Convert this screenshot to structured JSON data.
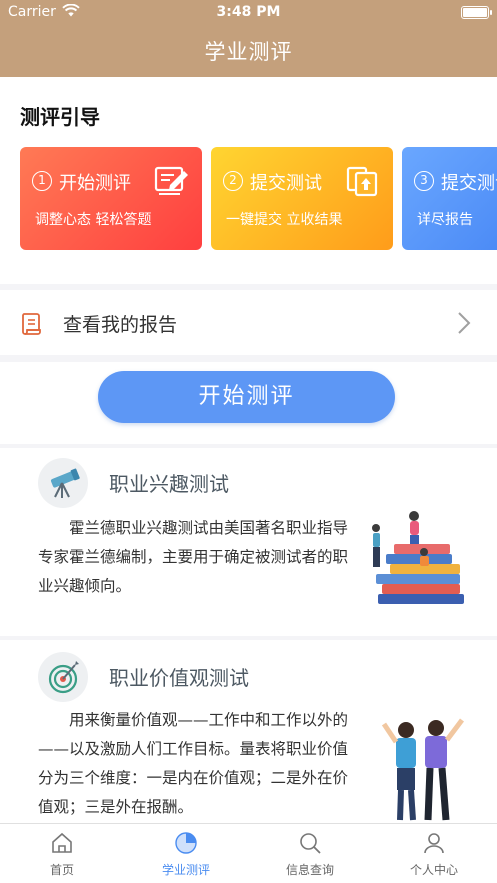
{
  "status_bar": {
    "carrier": "Carrier",
    "time": "3:48 PM"
  },
  "nav": {
    "title": "学业测评"
  },
  "guide": {
    "title": "测评引导",
    "cards": [
      {
        "num": "1",
        "title": "开始测评",
        "subtitle": "调整心态 轻松答题",
        "icon": "edit-icon"
      },
      {
        "num": "2",
        "title": "提交测试",
        "subtitle": "一键提交 立收结果",
        "icon": "copy-upload-icon"
      },
      {
        "num": "3",
        "title": "提交测试",
        "subtitle": "详尽报告",
        "icon": "report-icon"
      }
    ]
  },
  "report": {
    "label": "查看我的报告",
    "icon": "scroll-icon"
  },
  "start": {
    "button_label": "开始测评"
  },
  "tests": [
    {
      "title": "职业兴趣测试",
      "description": "霍兰德职业兴趣测试由美国著名职业指导专家霍兰德编制，主要用于确定被测试者的职业兴趣倾向。",
      "icon": "telescope-icon"
    },
    {
      "title": "职业价值观测试",
      "description": "用来衡量价值观——工作中和工作以外的——以及激励人们工作目标。量表将职业价值分为三个维度：一是内在价值观；二是外在价值观；三是外在报酬。",
      "icon": "target-icon"
    }
  ],
  "tabbar": {
    "tabs": [
      {
        "label": "首页",
        "icon": "home-icon",
        "active": false
      },
      {
        "label": "学业测评",
        "icon": "pie-chart-icon",
        "active": true
      },
      {
        "label": "信息查询",
        "icon": "search-icon",
        "active": false
      },
      {
        "label": "个人中心",
        "icon": "user-icon",
        "active": false
      }
    ]
  },
  "colors": {
    "header": "#c4a07c",
    "card1": "#ff4f45",
    "card2": "#ffb62a",
    "card3": "#4f8df6",
    "accent": "#5d97f5",
    "active_tab": "#4a8cf0"
  }
}
